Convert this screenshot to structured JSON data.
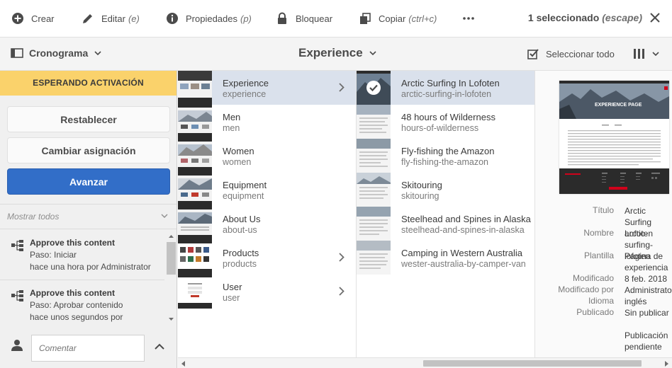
{
  "actionbar": {
    "create": "Crear",
    "edit": "Editar",
    "edit_shortcut": "(e)",
    "properties": "Propiedades",
    "properties_shortcut": "(p)",
    "lock": "Bloquear",
    "copy": "Copiar",
    "copy_shortcut": "(ctrl+c)",
    "more_icon": "ellipsis-icon",
    "selection_count": "1 seleccionado",
    "selection_escape": "(escape)"
  },
  "toolbar": {
    "rail_label": "Cronograma",
    "title": "Experience",
    "select_all": "Seleccionar todo",
    "view_icon": "column-view-icon"
  },
  "rail": {
    "status": "ESPERANDO ACTIVACIÓN",
    "buttons": {
      "reset": "Restablecer",
      "reassign": "Cambiar asignación",
      "advance": "Avanzar"
    },
    "show_all": "Mostrar todos",
    "timeline": [
      {
        "title": "Approve this content",
        "step": "Paso: Iniciar",
        "time": "hace una hora por Administrator"
      },
      {
        "title": "Approve this content",
        "step": "Paso: Aprobar contenido",
        "time": "hace unos segundos por"
      }
    ],
    "comment_placeholder": "Comentar"
  },
  "column1": [
    {
      "title": "Experience",
      "name": "experience",
      "has_children": true,
      "active": true
    },
    {
      "title": "Men",
      "name": "men",
      "has_children": false,
      "active": false
    },
    {
      "title": "Women",
      "name": "women",
      "has_children": false,
      "active": false
    },
    {
      "title": "Equipment",
      "name": "equipment",
      "has_children": false,
      "active": false
    },
    {
      "title": "About Us",
      "name": "about-us",
      "has_children": false,
      "active": false
    },
    {
      "title": "Products",
      "name": "products",
      "has_children": true,
      "active": false
    },
    {
      "title": "User",
      "name": "user",
      "has_children": true,
      "active": false
    }
  ],
  "column2": [
    {
      "title": "Arctic Surfing In Lofoten",
      "name": "arctic-surfing-in-lofoten",
      "selected": true
    },
    {
      "title": "48 hours of Wilderness",
      "name": "hours-of-wilderness",
      "selected": false
    },
    {
      "title": "Fly-fishing the Amazon",
      "name": "fly-fishing-the-amazon",
      "selected": false
    },
    {
      "title": "Skitouring",
      "name": "skitouring",
      "selected": false
    },
    {
      "title": "Steelhead and Spines in Alaska",
      "name": "steelhead-and-spines-in-alaska",
      "selected": false
    },
    {
      "title": "Camping in Western Australia",
      "name": "wester-australia-by-camper-van",
      "selected": false
    }
  ],
  "details": {
    "preview_heading": "EXPERIENCE PAGE",
    "meta": [
      {
        "key": "Título",
        "value": "Arctic Surfing Lofoten"
      },
      {
        "key": "Nombre",
        "value": "arctic-surfing-lofoten"
      },
      {
        "key": "Plantilla",
        "value": "Página de experiencia"
      },
      {
        "key": "Modificado",
        "value": "8 feb. 2018"
      },
      {
        "key": "Modificado por",
        "value": "Administrator"
      },
      {
        "key": "Idioma",
        "value": "inglés"
      },
      {
        "key": "Publicado",
        "value": "Sin publicar"
      },
      {
        "key": "",
        "value": ""
      },
      {
        "key": "",
        "value": "Publicación pendiente"
      }
    ]
  },
  "colors": {
    "status_banner": "#fad26b",
    "primary_button": "#326ec8",
    "active_row": "#dae1ec"
  }
}
